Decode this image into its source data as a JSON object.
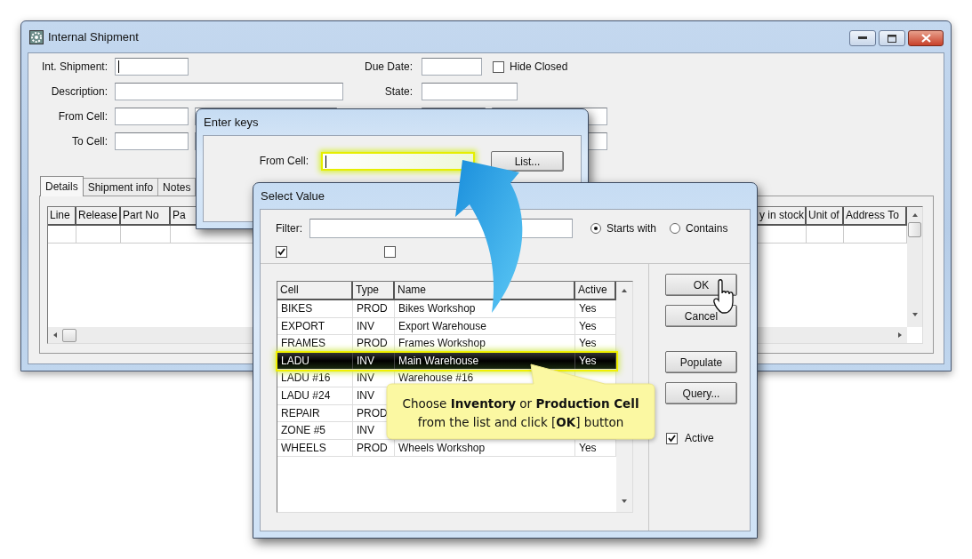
{
  "window": {
    "title": "Internal Shipment"
  },
  "form": {
    "left_fields": [
      {
        "label": "Int. Shipment:",
        "cursor": true
      },
      {
        "label": "Description:",
        "cursor": false
      },
      {
        "label": "From Cell:",
        "cursor": false
      },
      {
        "label": "To Cell:",
        "cursor": false
      }
    ],
    "right_fields": [
      {
        "label": "Due Date:"
      },
      {
        "label": "State:"
      }
    ],
    "hide_closed": {
      "label": "Hide Closed",
      "checked": false
    }
  },
  "tabs": [
    {
      "label": "Details",
      "selected": true
    },
    {
      "label": "Shipment info",
      "selected": false
    },
    {
      "label": "Notes",
      "selected": false
    }
  ],
  "grid": {
    "left_columns": [
      "Line",
      "Release",
      "Part No",
      "Pa"
    ],
    "right_columns": [
      "y in stock",
      "Unit of",
      "Address To"
    ]
  },
  "enter_keys": {
    "title": "Enter keys",
    "field_label": "From Cell:",
    "button": "List..."
  },
  "select_value": {
    "title": "Select Value",
    "filter_label": "Filter:",
    "match_options": [
      {
        "label": "Starts with",
        "selected": true
      },
      {
        "label": "Contains",
        "selected": false
      }
    ],
    "flags": [
      {
        "checked": true
      },
      {
        "checked": false
      }
    ],
    "columns": [
      "Cell",
      "Type",
      "Name",
      "Active"
    ],
    "rows": [
      {
        "cell": "BIKES",
        "type": "PROD",
        "name": "Bikes Workshop",
        "active": "Yes",
        "selected": false
      },
      {
        "cell": "EXPORT",
        "type": "INV",
        "name": "Export Warehouse",
        "active": "Yes",
        "selected": false
      },
      {
        "cell": "FRAMES",
        "type": "PROD",
        "name": "Frames Workshop",
        "active": "Yes",
        "selected": false
      },
      {
        "cell": "LADU",
        "type": "INV",
        "name": "Main Warehouse",
        "active": "Yes",
        "selected": true
      },
      {
        "cell": "LADU #16",
        "type": "INV",
        "name": "Warehouse #16",
        "selected": false
      },
      {
        "cell": "LADU #24",
        "type": "INV",
        "selected": false
      },
      {
        "cell": "REPAIR",
        "type": "PROD",
        "selected": false
      },
      {
        "cell": "ZONE #5",
        "type": "INV",
        "selected": false
      },
      {
        "cell": "WHEELS",
        "type": "PROD",
        "name": "Wheels Workshop",
        "active": "Yes",
        "selected": false
      }
    ],
    "buttons": [
      {
        "label": "OK",
        "kind": "primary"
      },
      {
        "label": "Cancel",
        "kind": "primary"
      },
      {
        "label": "Populate",
        "kind": "secondary"
      },
      {
        "label": "Query...",
        "kind": "secondary"
      }
    ],
    "active": {
      "label": "Active",
      "checked": true
    }
  },
  "callout": {
    "lines": [
      "Choose **Inventory** or **Production  Cell**",
      "from the list and click [**OK**] button"
    ]
  }
}
